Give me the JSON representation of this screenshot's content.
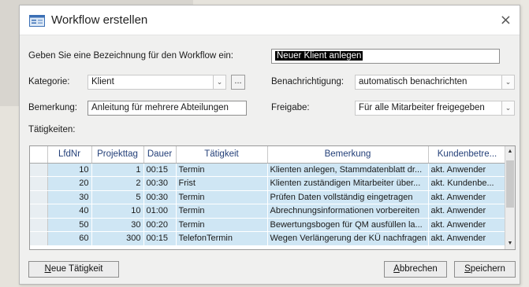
{
  "window": {
    "title": "Workflow erstellen",
    "close_glyph": "×"
  },
  "form": {
    "name_prompt": "Geben Sie eine Bezeichnung für den Workflow ein:",
    "name_value": "Neuer Klient anlegen",
    "category_label": "Kategorie:",
    "category_value": "Klient",
    "ellipsis_label": "...",
    "notify_label": "Benachrichtigung:",
    "notify_value": "automatisch benachrichten",
    "remark_label": "Bemerkung:",
    "remark_value": "Anleitung für mehrere Abteilungen",
    "release_label": "Freigabe:",
    "release_value": "Für alle Mitarbeiter freigegeben",
    "tasks_label": "Tätigkeiten:"
  },
  "grid": {
    "columns": [
      "LfdNr",
      "Projekttag",
      "Dauer",
      "Tätigkeit",
      "Bemerkung",
      "Kundenbetre..."
    ],
    "rows": [
      [
        "10",
        "1",
        "00:15",
        "Termin",
        "Klienten anlegen, Stammdatenblatt dr...",
        "akt. Anwender"
      ],
      [
        "20",
        "2",
        "00:30",
        "Frist",
        "Klienten zuständigen Mitarbeiter über...",
        "akt. Kundenbe..."
      ],
      [
        "30",
        "5",
        "00:30",
        "Termin",
        "Prüfen Daten vollständig eingetragen",
        "akt. Anwender"
      ],
      [
        "40",
        "10",
        "01:00",
        "Termin",
        "Abrechnungsinformationen vorbereiten",
        "akt. Anwender"
      ],
      [
        "50",
        "30",
        "00:20",
        "Termin",
        "Bewertungsbogen für QM ausfüllen la...",
        "akt. Anwender"
      ],
      [
        "60",
        "300",
        "00:15",
        "TelefonTermin",
        "Wegen Verlängerung der KÜ nachfragen",
        "akt. Anwender"
      ]
    ]
  },
  "buttons": {
    "new_task_u": "N",
    "new_task_rest": "eue Tätigkeit",
    "cancel_u": "A",
    "cancel_rest": "bbrechen",
    "save_u": "S",
    "save_rest": "peichern"
  },
  "icons": {
    "app": "form-icon",
    "dropdown": "chevron-down-icon",
    "scroll_up": "▲",
    "scroll_down": "▼"
  },
  "colors": {
    "row_bg": "#cfe6f4",
    "header_text": "#233f78",
    "dialog_bg": "#f0f0ef"
  }
}
